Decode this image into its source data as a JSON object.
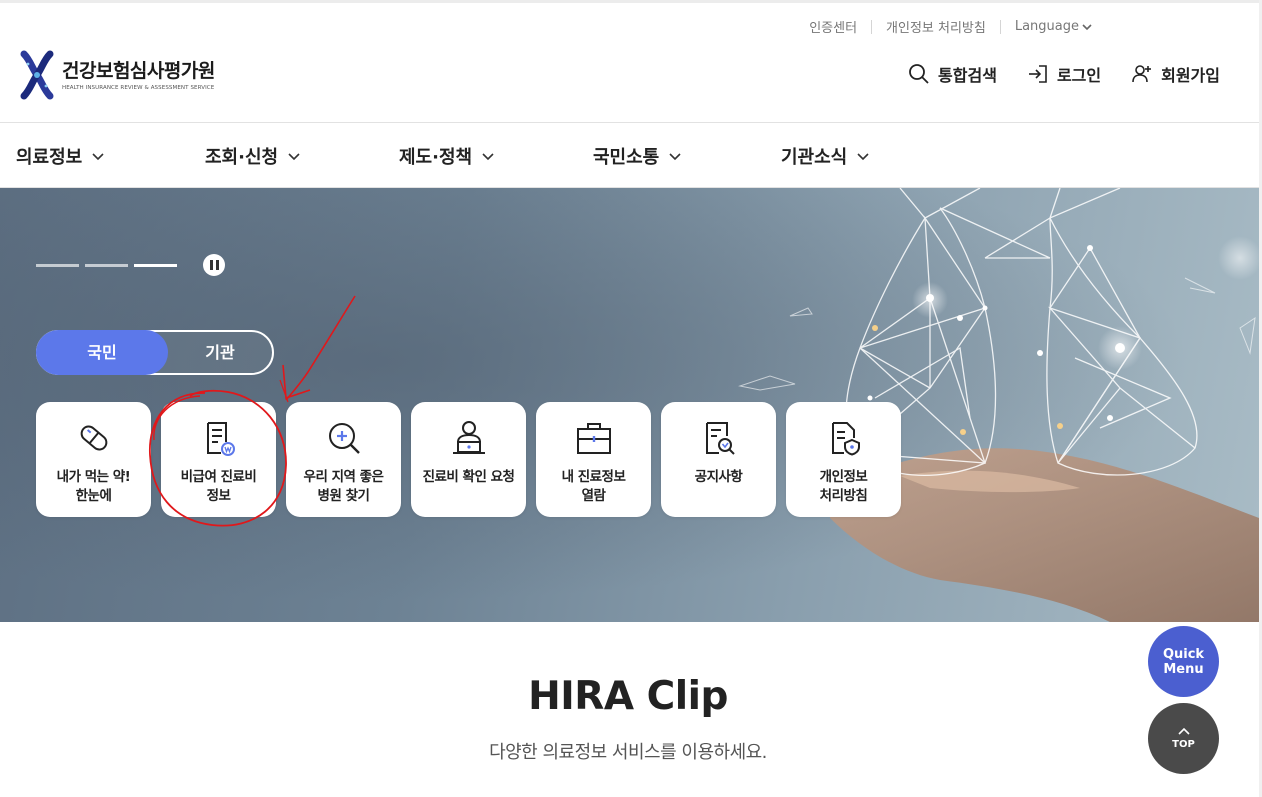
{
  "utility_links": {
    "cert_center": "인증센터",
    "privacy_policy": "개인정보 처리방침",
    "language": "Language"
  },
  "logo": {
    "name_kr": "건강보험심사평가원",
    "name_en": "HEALTH INSURANCE REVIEW & ASSESSMENT SERVICE"
  },
  "header_actions": {
    "search": "통합검색",
    "login": "로그인",
    "signup": "회원가입"
  },
  "gnb": {
    "items": [
      {
        "label": "의료정보"
      },
      {
        "label": "조회·신청"
      },
      {
        "label": "제도·정책"
      },
      {
        "label": "국민소통"
      },
      {
        "label": "기관소식"
      }
    ]
  },
  "hero": {
    "slider": {
      "total": 3,
      "current": 3
    },
    "toggle": {
      "citizen": "국민",
      "institution": "기관",
      "selected": "국민"
    },
    "cards": [
      {
        "icon": "pill-icon",
        "label": "내가 먹는 약!\n한눈에"
      },
      {
        "icon": "won-document-icon",
        "label": "비급여 진료비\n정보"
      },
      {
        "icon": "magnifier-plus-icon",
        "label": "우리 지역 좋은\n병원 찾기"
      },
      {
        "icon": "person-laptop-icon",
        "label": "진료비 확인 요청"
      },
      {
        "icon": "briefcase-icon",
        "label": "내 진료정보\n열람"
      },
      {
        "icon": "document-search-icon",
        "label": "공지사항"
      },
      {
        "icon": "document-shield-icon",
        "label": "개인정보\n처리방침"
      }
    ]
  },
  "annotation": {
    "color": "#e0181b",
    "target": "비급여 진료비 정보"
  },
  "clip": {
    "title": "HIRA Clip",
    "subtitle": "다양한 의료정보 서비스를 이용하세요."
  },
  "floating": {
    "quick_menu_line1": "Quick",
    "quick_menu_line2": "Menu",
    "top": "TOP"
  },
  "colors": {
    "accent": "#5c78ea",
    "quick_menu": "#4b5fd0",
    "top_button": "#4a4a4a"
  }
}
